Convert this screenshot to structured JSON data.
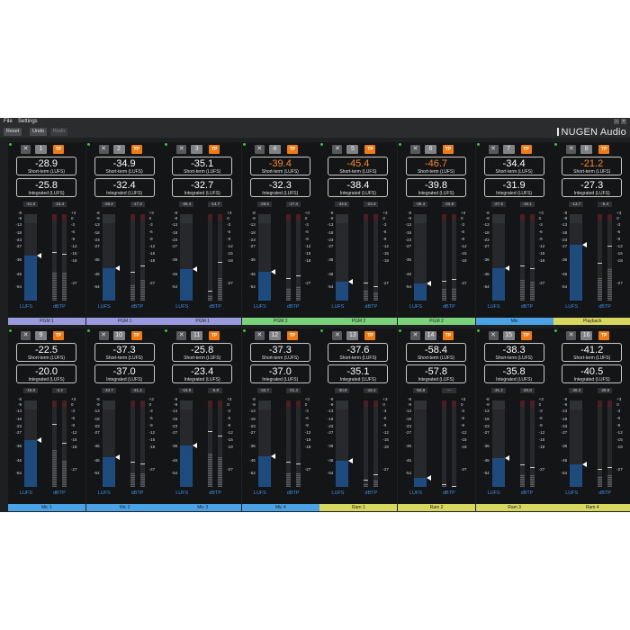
{
  "menu": {
    "file": "File",
    "settings": "Settings"
  },
  "toolbar": {
    "reset": "Reset",
    "undo": "Undo",
    "redo": "Redo"
  },
  "brand": {
    "logo_text": "NUGEN",
    "logo_suffix": "Audio"
  },
  "labels": {
    "short_term": "Short-term (LUFS)",
    "integrated": "Integrated (LUFS)",
    "x": "✕",
    "tp": "TP",
    "lufs": "LUFS",
    "dbtp": "dBTP"
  },
  "scale_left": [
    "-8",
    "-9",
    "-13",
    "-18",
    "-23",
    "-27",
    "-36",
    "-46",
    "-54"
  ],
  "scale_right": [
    "+3",
    "0",
    "-3",
    "-6",
    "-9",
    "-12",
    "-15",
    "-18",
    "-27"
  ],
  "group_colors": {
    "PGM 1": "#9a9adf",
    "PGM 2": "#7ad37a",
    "Mix": "#4aa3e6",
    "Playback": "#d8d860",
    "Mic": "#4aa3e6",
    "Ram": "#d8d860"
  },
  "channels": [
    {
      "num": "1",
      "short_term": "-28.9",
      "integrated": "-25.8",
      "peak_l": "-21.0",
      "peak_r": "-15.4",
      "group": "PGM 1",
      "color": "#9a9adf",
      "level": 0.52,
      "tp1": 0.55,
      "tp2": 0.53,
      "hot": false
    },
    {
      "num": "2",
      "short_term": "-34.9",
      "integrated": "-32.4",
      "peak_l": "-28.2",
      "peak_r": "-17.3",
      "group": "PGM 1",
      "color": "#9a9adf",
      "level": 0.38,
      "tp1": 0.32,
      "tp2": 0.4,
      "hot": false
    },
    {
      "num": "3",
      "short_term": "-35.1",
      "integrated": "-32.7",
      "peak_l": "-26.4",
      "peak_r": "-14.7",
      "group": "PGM 1",
      "color": "#9a9adf",
      "level": 0.36,
      "tp1": 0.1,
      "tp2": 0.44,
      "hot": false
    },
    {
      "num": "4",
      "short_term": "-39.4",
      "integrated": "-32.3",
      "peak_l": "-28.5",
      "peak_r": "-17.3",
      "group": "PGM 2",
      "color": "#7ad37a",
      "level": 0.33,
      "tp1": 0.25,
      "tp2": 0.28,
      "hot": true
    },
    {
      "num": "5",
      "short_term": "-45.4",
      "integrated": "-38.4",
      "peak_l": "-34.5",
      "peak_r": "-23.3",
      "group": "PGM 2",
      "color": "#7ad37a",
      "level": 0.22,
      "tp1": 0.2,
      "tp2": 0.16,
      "hot": true
    },
    {
      "num": "6",
      "short_term": "-46.7",
      "integrated": "-39.8",
      "peak_l": "-36.4",
      "peak_r": "-22.8",
      "group": "PGM 2",
      "color": "#7ad37a",
      "level": 0.2,
      "tp1": 0.22,
      "tp2": 0.24,
      "hot": true
    },
    {
      "num": "7",
      "short_term": "-34.4",
      "integrated": "-31.9",
      "peak_l": "-27.3",
      "peak_r": "-16.1",
      "group": "Mix",
      "color": "#4aa3e6",
      "level": 0.38,
      "tp1": 0.4,
      "tp2": 0.36,
      "hot": false
    },
    {
      "num": "8",
      "short_term": "-21.2",
      "integrated": "-27.3",
      "peak_l": "-13.7",
      "peak_r": "-5.4",
      "group": "Playback",
      "color": "#d8d860",
      "level": 0.65,
      "tp1": 0.43,
      "tp2": 0.63,
      "hot": true
    },
    {
      "num": "9",
      "short_term": "-22.5",
      "integrated": "-20.0",
      "peak_l": "-15.5",
      "peak_r": "-2.2",
      "group": "Mic 1",
      "color": "#4aa3e6",
      "level": 0.54,
      "tp1": 0.72,
      "tp2": 0.5,
      "hot": false
    },
    {
      "num": "10",
      "short_term": "-37.3",
      "integrated": "-37.0",
      "peak_l": "-33.7",
      "peak_r": "-21.4",
      "group": "Mic 2",
      "color": "#4aa3e6",
      "level": 0.34,
      "tp1": 0.28,
      "tp2": 0.26,
      "hot": false
    },
    {
      "num": "11",
      "short_term": "-25.8",
      "integrated": "-23.4",
      "peak_l": "-16.9",
      "peak_r": "-5.8",
      "group": "Mic 3",
      "color": "#4aa3e6",
      "level": 0.48,
      "tp1": 0.64,
      "tp2": 0.58,
      "hot": false
    },
    {
      "num": "12",
      "short_term": "-37.3",
      "integrated": "-37.0",
      "peak_l": "-33.7",
      "peak_r": "-21.4",
      "group": "Mic 4",
      "color": "#4aa3e6",
      "level": 0.35,
      "tp1": 0.28,
      "tp2": 0.26,
      "hot": false
    },
    {
      "num": "13",
      "short_term": "-37.6",
      "integrated": "-35.1",
      "peak_l": "-30.8",
      "peak_r": "-16.4",
      "group": "Ram 1",
      "color": "#d8d860",
      "level": 0.3,
      "tp1": 0.07,
      "tp2": 0.14,
      "hot": false
    },
    {
      "num": "14",
      "short_term": "-58.4",
      "integrated": "-57.8",
      "peak_l": "-50.8",
      "peak_r": "—",
      "group": "Ram 2",
      "color": "#d8d860",
      "level": 0.1,
      "tp1": 0.02,
      "tp2": 0.0,
      "hot": false
    },
    {
      "num": "15",
      "short_term": "-38.3",
      "integrated": "-35.8",
      "peak_l": "-31.2",
      "peak_r": "-20.0",
      "group": "Ram 3",
      "color": "#d8d860",
      "level": 0.33,
      "tp1": 0.25,
      "tp2": 0.22,
      "hot": false
    },
    {
      "num": "16",
      "short_term": "-41.2",
      "integrated": "-40.5",
      "peak_l": "-36.3",
      "peak_r": "-28.6",
      "group": "Ram 4",
      "color": "#d8d860",
      "level": 0.26,
      "tp1": 0.2,
      "tp2": 0.22,
      "hot": false
    }
  ]
}
